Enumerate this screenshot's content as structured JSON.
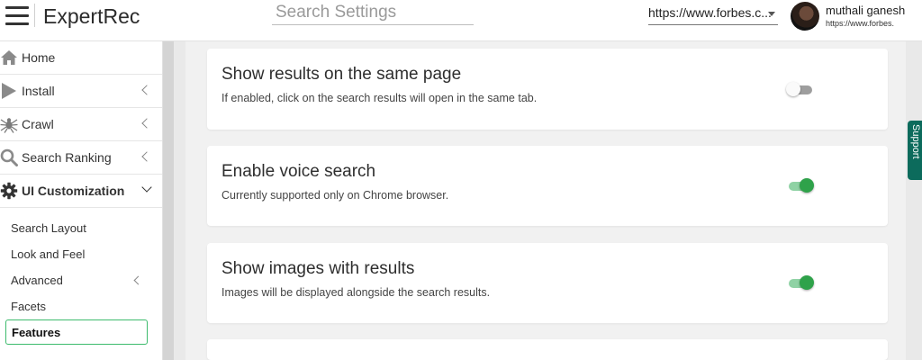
{
  "header": {
    "brand": "ExpertRec",
    "search_placeholder": "Search Settings",
    "site_select": "https://www.forbes.c...",
    "user_name": "muthali ganesh",
    "user_site": "https://www.forbes."
  },
  "sidebar": {
    "items": [
      {
        "label": "Home",
        "icon": "home-icon"
      },
      {
        "label": "Install",
        "icon": "play-icon"
      },
      {
        "label": "Crawl",
        "icon": "spider-icon"
      },
      {
        "label": "Search Ranking",
        "icon": "search-icon"
      },
      {
        "label": "UI Customization",
        "icon": "gear-icon"
      }
    ],
    "subitems": [
      {
        "label": "Search Layout"
      },
      {
        "label": "Look and Feel"
      },
      {
        "label": "Advanced"
      },
      {
        "label": "Facets"
      },
      {
        "label": "Features"
      }
    ]
  },
  "cards": [
    {
      "title": "Show results on the same page",
      "description": "If enabled, click on the search results will open in the same tab.",
      "enabled": false
    },
    {
      "title": "Enable voice search",
      "description": "Currently supported only on Chrome browser.",
      "enabled": true
    },
    {
      "title": "Show images with results",
      "description": "Images will be displayed alongside the search results.",
      "enabled": true
    }
  ],
  "support_label": "Support",
  "colors": {
    "toggle_on": "#2fa24a",
    "toggle_on_track": "#8fd2a4",
    "toggle_off_track": "#9e9e9e",
    "selected_border": "#3dbb6d",
    "support_tab": "#0c6b5c"
  }
}
